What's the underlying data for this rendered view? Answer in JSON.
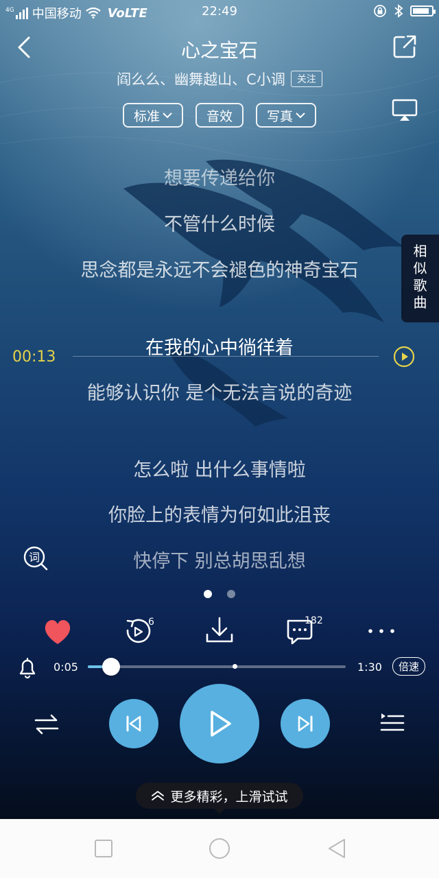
{
  "status_bar": {
    "network": "4G",
    "carrier": "中国移动",
    "volte": "VoLTE",
    "time": "22:49",
    "battery_level": 0.9
  },
  "header": {
    "title": "心之宝石",
    "artists": "阎么么、幽舞越山、C小调",
    "follow_label": "关注"
  },
  "options": {
    "quality_label": "标准",
    "effects_label": "音效",
    "photo_label": "写真"
  },
  "lyrics": [
    {
      "text": "想要传递给你",
      "state": "dim"
    },
    {
      "text": "不管什么时候",
      "state": "normal"
    },
    {
      "text": "思念都是永远不会褪色的神奇宝石",
      "state": "normal"
    },
    {
      "text": "在我的心中徜徉着",
      "state": "current"
    },
    {
      "text": "能够认识你 是个无法言说的奇迹",
      "state": "normal"
    },
    {
      "text": "怎么啦 出什么事情啦",
      "state": "normal"
    },
    {
      "text": "你脸上的表情为何如此沮丧",
      "state": "normal"
    },
    {
      "text": "快停下 别总胡思乱想",
      "state": "dim"
    }
  ],
  "lyric_position_time": "00:13",
  "similar_songs_label": [
    "相",
    "似",
    "歌",
    "曲"
  ],
  "page_indicator": {
    "count": 2,
    "active": 0
  },
  "actions": {
    "liked": true,
    "listen_badge": "6",
    "comment_count": "182"
  },
  "playback": {
    "current_time": "0:05",
    "total_time": "1:30",
    "progress_fraction": 0.09,
    "buffer_fraction": 0.57,
    "speed_label": "倍速"
  },
  "swipe_tip": "更多精彩，上滑试试",
  "colors": {
    "accent": "#57b0e0",
    "lyric_time": "#e5d34a",
    "heart": "#f0545c"
  }
}
